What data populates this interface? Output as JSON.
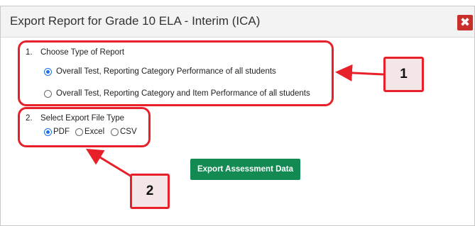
{
  "dialog": {
    "title": "Export Report for Grade 10 ELA - Interim (ICA)",
    "close_glyph": "✖",
    "close_icon": "close-icon"
  },
  "section1": {
    "number": "1.",
    "heading": "Choose Type of Report",
    "options": [
      {
        "label": "Overall Test, Reporting Category Performance of all students",
        "selected": true
      },
      {
        "label": "Overall Test, Reporting Category and Item Performance of all students",
        "selected": false
      }
    ]
  },
  "section2": {
    "number": "2.",
    "heading": "Select Export File Type",
    "options": [
      {
        "label": "PDF",
        "selected": true
      },
      {
        "label": "Excel",
        "selected": false
      },
      {
        "label": "CSV",
        "selected": false
      }
    ]
  },
  "export_button": {
    "label": "Export Assessment Data"
  },
  "callouts": [
    {
      "label": "1"
    },
    {
      "label": "2"
    }
  ],
  "colors": {
    "callout_red": "#e8202a",
    "badge_fill": "#f4e6e6",
    "export_green": "#138a52",
    "close_red": "#c9302c",
    "radio_blue": "#1a73e8"
  }
}
